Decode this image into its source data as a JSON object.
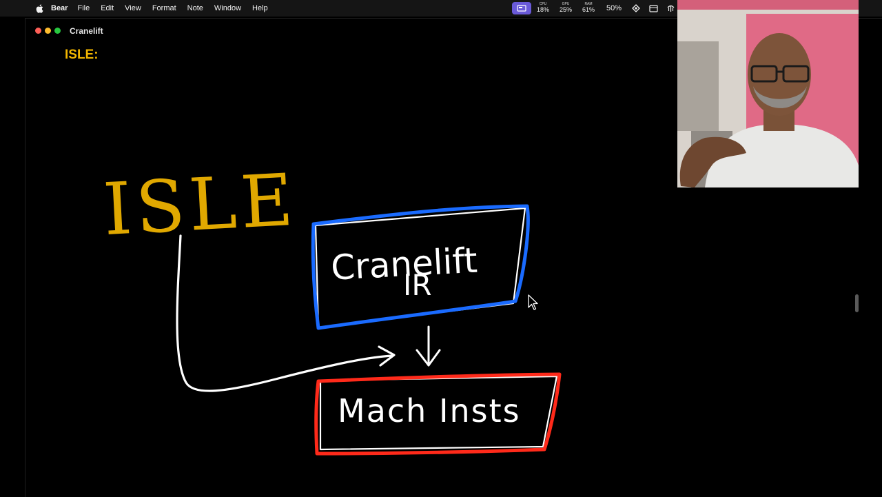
{
  "menubar": {
    "items": [
      "Bear",
      "File",
      "Edit",
      "View",
      "Format",
      "Note",
      "Window",
      "Help"
    ],
    "stats": [
      {
        "label": "CPU",
        "value": "18%"
      },
      {
        "label": "GPU",
        "value": "25%"
      },
      {
        "label": "RAM",
        "value": "61%"
      }
    ],
    "battery": "50%"
  },
  "window": {
    "title": "Cranelift",
    "heading": "ISLE:"
  },
  "drawing": {
    "isle_text": "ISLE",
    "ir_line1": "Cranelift",
    "ir_line2": "IR",
    "mach_text": "Mach Insts"
  },
  "colors": {
    "heading": "#f2b600",
    "ink_yellow": "#e0a800",
    "ink_blue": "#1a6bff",
    "ink_red": "#ff2a1a",
    "ink_white": "#ffffff",
    "accent_badge": "#6a5ad8"
  }
}
